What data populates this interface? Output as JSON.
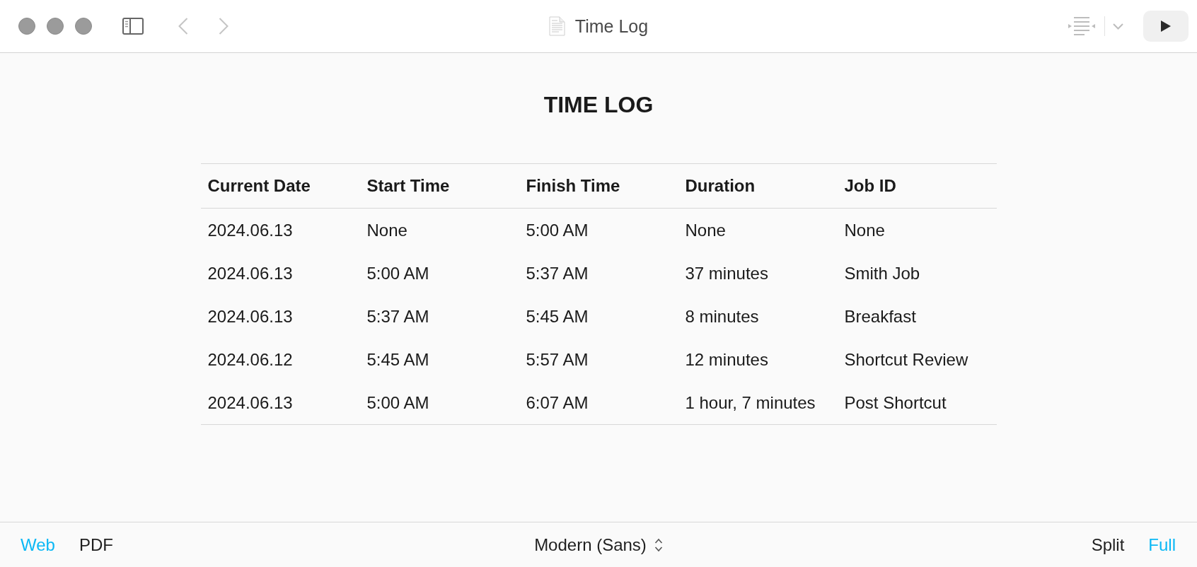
{
  "window": {
    "title": "Time Log"
  },
  "toolbar": {
    "back_button": {
      "disabled": true
    },
    "forward_button": {
      "disabled": true
    }
  },
  "document": {
    "heading": "TIME LOG",
    "table": {
      "columns": [
        "Current Date",
        "Start Time",
        "Finish Time",
        "Duration",
        "Job ID"
      ],
      "rows": [
        [
          "2024.06.13",
          "None",
          "5:00 AM",
          "None",
          "None"
        ],
        [
          "2024.06.13",
          "5:00 AM",
          "5:37 AM",
          "37 minutes",
          "Smith Job"
        ],
        [
          "2024.06.13",
          "5:37 AM",
          "5:45 AM",
          "8 minutes",
          "Breakfast"
        ],
        [
          "2024.06.12",
          "5:45 AM",
          "5:57 AM",
          "12 minutes",
          "Shortcut Review"
        ],
        [
          "2024.06.13",
          "5:00 AM",
          "6:07 AM",
          "1 hour, 7 minutes",
          "Post Shortcut"
        ]
      ]
    }
  },
  "bottom_bar": {
    "output_tabs": [
      {
        "label": "Web",
        "selected": true
      },
      {
        "label": "PDF",
        "selected": false
      }
    ],
    "style_picker": {
      "value": "Modern (Sans)"
    },
    "layout_tabs": [
      {
        "label": "Split",
        "selected": false
      },
      {
        "label": "Full",
        "selected": true
      }
    ]
  }
}
